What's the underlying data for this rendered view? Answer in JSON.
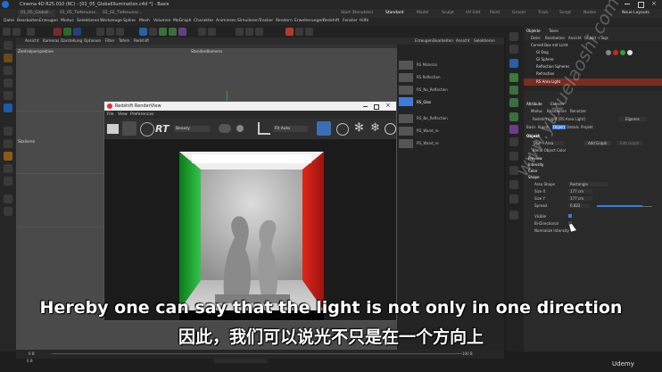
{
  "window": {
    "title": "Cinema 4D R25.010 (RC) - [01_05_GlobalIllumination.c4d *] - Basis"
  },
  "doc_tabs": [
    "01_05_GlobalI...",
    "01_05_Tiefenunsc...",
    "02_02_Tiefenunsc..."
  ],
  "layout_tabs": [
    "Start (Benutzer)",
    "Standard",
    "Model",
    "Sculpt",
    "UV Edit",
    "Paint",
    "Groom",
    "Track",
    "Script",
    "Nodes"
  ],
  "layout_new": "Neue Layouts",
  "menubar": [
    "Datei",
    "Bearbeiten",
    "Erzeugen",
    "Modus",
    "Selektieren",
    "Werkzeuge",
    "Spline",
    "Mesh",
    "Volumen",
    "MoGraph",
    "Charakter",
    "Animieren",
    "Simulieren",
    "Tracker",
    "Rendern",
    "Erweiterungen",
    "Redshift",
    "Fenster",
    "Hilfe"
  ],
  "viewport": {
    "menu": [
      "Ansicht",
      "Kameras",
      "Darstellung",
      "Optionen",
      "Filter",
      "Tafeln",
      "Redshift"
    ],
    "label_left": "Zentralperspektive",
    "label_camera": "Standardkamera",
    "label_side": "Skalieren"
  },
  "material_panel": {
    "tabs": [
      "Erzeugen",
      "Bearbeiten",
      "Ansicht",
      "Selektieren"
    ],
    "materials": [
      "RS Material",
      "RS Reflection",
      "RS_No_Reflection",
      "RS_Glas",
      "RS_No_Reflection",
      "RS_Wand_re",
      "RS_Wand_re"
    ]
  },
  "objects_panel": {
    "tabs": [
      "Objekte",
      "Takes"
    ],
    "menu": [
      "Datei",
      "Bearbeiten",
      "Ansicht",
      "Objekt",
      "Tags"
    ],
    "items": [
      "Cornell Box mit Licht",
      "GI Dog",
      "GI Sphere",
      "Reflection Spheres",
      "Refraction",
      "RS Area Light"
    ]
  },
  "attributes_panel": {
    "tabs": [
      "Attribute",
      "Ebenen"
    ],
    "menu": [
      "Modus",
      "Bearbeiten",
      "Benutzer"
    ],
    "object_title": "Redshift Light [RS Area Light]",
    "mode": "Eigenes",
    "subtabs": [
      "Basis",
      "Koord.",
      "Objekt",
      "Details",
      "Projekt"
    ],
    "section_object": "Objekt",
    "type_label": "Type",
    "type_value": "Area",
    "add_graph": "Add Graph",
    "edit_graph": "Edit Graph",
    "blend_color": "Blend Object Color",
    "sections": [
      "Preview",
      "Intensity",
      "Color",
      "Shape"
    ],
    "area_shape_label": "Area Shape",
    "area_shape_value": "Rectangle",
    "size_x_label": "Size X",
    "size_x_value": "177 cm",
    "size_y_label": "Size Y",
    "size_y_value": "177 cm",
    "spread_label": "Spread",
    "spread_value": "0.822",
    "visible_label": "Visible",
    "bidirectional_label": "Bi-Directional",
    "normalize_label": "Normalize Intensity"
  },
  "render_view": {
    "title": "Redshift RenderView",
    "menu": [
      "File",
      "View",
      "Preferences"
    ],
    "rt_label": "RT",
    "mode": "Beauty",
    "zoom": "Fit Auto"
  },
  "timeline": {
    "start": "0 B",
    "end": "100 B",
    "current": "0 B"
  },
  "subtitles": {
    "en": "Hereby one can say that the light is not only in one direction",
    "zh": "因此，我们可以说光不只是在一个方向上"
  },
  "watermark": "www.yuxuelaoshi.com",
  "brand": "Udemy",
  "colors": {
    "accent": "#3b7dd8",
    "red_wall": "#c81a14",
    "green_wall": "#1da42a",
    "light": "#ffffff"
  }
}
